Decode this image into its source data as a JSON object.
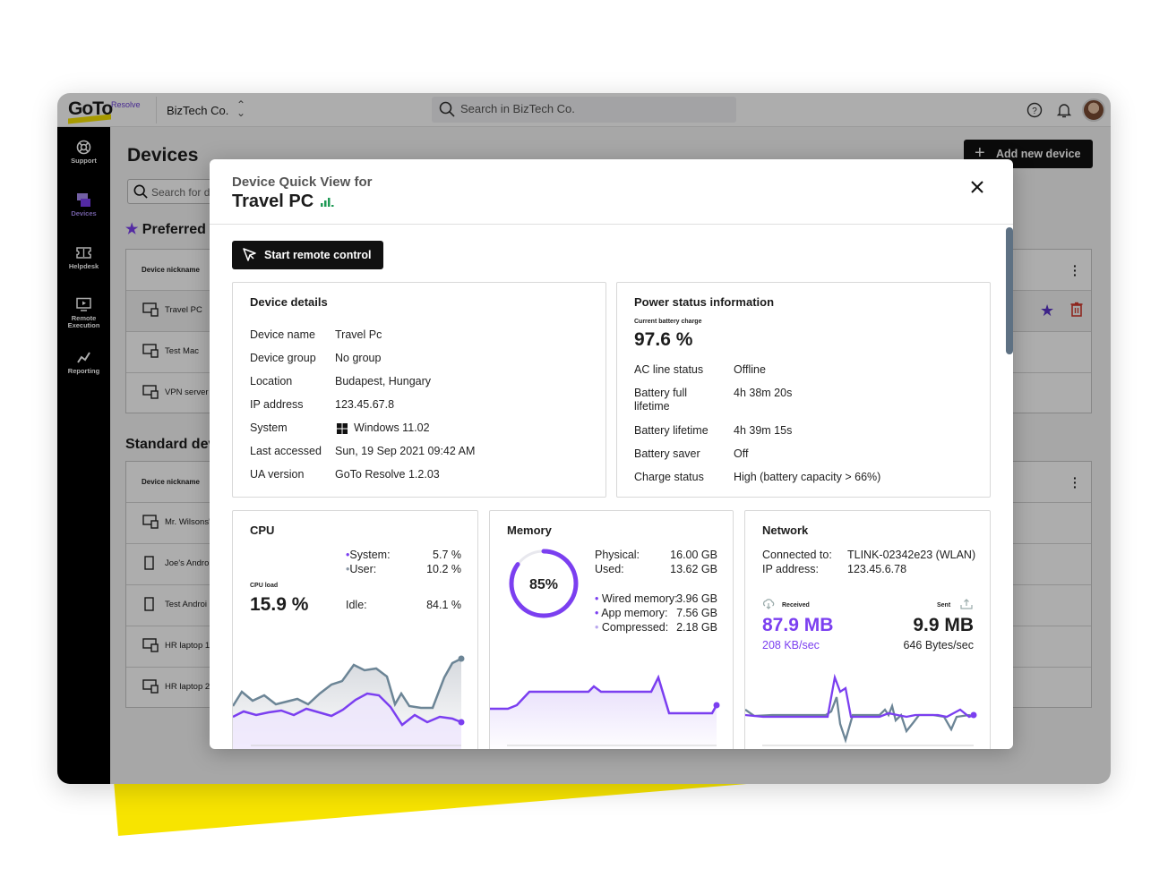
{
  "brand": {
    "logo_text": "GoTo",
    "product": "Resolve",
    "accent": "#7b3ff0",
    "yellow": "#f7e400"
  },
  "topbar": {
    "company": "BizTech Co.",
    "search_placeholder": "Search in BizTech Co.",
    "icons": [
      "help-icon",
      "bell-icon"
    ]
  },
  "sidebar": {
    "items": [
      {
        "label": "Support",
        "icon": "lifebuoy-icon"
      },
      {
        "label": "Devices",
        "icon": "devices-icon",
        "active": true
      },
      {
        "label": "Helpdesk",
        "icon": "ticket-icon"
      },
      {
        "label": "Remote",
        "label2": "Execution",
        "icon": "monitor-play-icon"
      },
      {
        "label": "Reporting",
        "icon": "chart-line-icon"
      }
    ]
  },
  "page": {
    "title": "Devices",
    "add_button": "Add new device",
    "search_placeholder": "Search for d",
    "preferred_title": "Preferred",
    "standard_title": "Standard dev",
    "column_header": "Device nickname",
    "preferred_rows": [
      "Travel PC",
      "Test Mac",
      "VPN server"
    ],
    "standard_rows": [
      "Mr. Wilsons'",
      "Joe's Androi",
      "Test Androi",
      "HR laptop 1",
      "HR laptop 2"
    ]
  },
  "modal": {
    "subtitle": "Device Quick View for",
    "title": "Travel PC",
    "remote_button": "Start remote control",
    "device_details": {
      "title": "Device details",
      "rows": [
        {
          "label": "Device name",
          "value": "Travel Pc"
        },
        {
          "label": "Device group",
          "value": "No group"
        },
        {
          "label": "Location",
          "value": "Budapest, Hungary"
        },
        {
          "label": "IP address",
          "value": "123.45.67.8"
        },
        {
          "label": "System",
          "value": "Windows 11.02"
        },
        {
          "label": "Last accessed",
          "value": "Sun, 19 Sep 2021 09:42 AM"
        },
        {
          "label": "UA version",
          "value": "GoTo Resolve 1.2.03"
        }
      ]
    },
    "power": {
      "title": "Power status information",
      "charge_label": "Current battery charge",
      "charge_value": "97.6 %",
      "rows": [
        {
          "label": "AC line status",
          "value": "Offline"
        },
        {
          "label": "Battery full",
          "label2": "lifetime",
          "value": "4h 38m 20s"
        },
        {
          "label": "Battery lifetime",
          "value": "4h 39m 15s"
        },
        {
          "label": "Battery saver",
          "value": "Off"
        },
        {
          "label": "Charge status",
          "value": "High (battery capacity > 66%)"
        }
      ]
    },
    "cpu": {
      "title": "CPU",
      "load_label": "CPU load",
      "load_value": "15.9 %",
      "system_label": "System:",
      "system_value": "5.7 %",
      "user_label": "User:",
      "user_value": "10.2 %",
      "idle_label": "Idle:",
      "idle_value": "84.1 %"
    },
    "memory": {
      "title": "Memory",
      "gauge_value": "85%",
      "gauge_fraction": 0.85,
      "physical_label": "Physical:",
      "physical_value": "16.00 GB",
      "used_label": "Used:",
      "used_value": "13.62 GB",
      "wired_label": "Wired memory:",
      "wired_value": "3.96 GB",
      "app_label": "App memory:",
      "app_value": "7.56 GB",
      "compressed_label": "Compressed:",
      "compressed_value": "2.18 GB"
    },
    "network": {
      "title": "Network",
      "connected_label": "Connected to:",
      "connected_value": "TLINK-02342e23 (WLAN)",
      "ip_label": "IP address:",
      "ip_value": "123.45.6.78",
      "received_label": "Received",
      "received_value": "87.9 MB",
      "received_rate": "208 KB/sec",
      "sent_label": "Sent",
      "sent_value": "9.9 MB",
      "sent_rate": "646 Bytes/sec"
    }
  }
}
